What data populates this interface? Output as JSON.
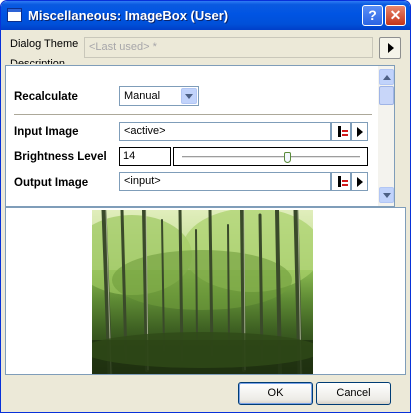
{
  "window": {
    "title": "Miscellaneous: ImageBox (User)",
    "help_glyph": "?",
    "close_glyph": "✕",
    "titlebar_color": "#0054e3"
  },
  "theme": {
    "label": "Dialog Theme",
    "value": "<Last used> *"
  },
  "description": {
    "label": "Description"
  },
  "params": {
    "recalculate": {
      "label": "Recalculate",
      "value": "Manual"
    },
    "input_image": {
      "label": "Input Image",
      "value": "<active>"
    },
    "brightness": {
      "label": "Brightness Level",
      "value": "14",
      "slider_fraction": 0.6
    },
    "output_image": {
      "label": "Output Image",
      "value": "<input>"
    }
  },
  "buttons": {
    "ok": "OK",
    "cancel": "Cancel"
  },
  "icons": [
    "window-icon",
    "help-icon",
    "close-icon",
    "expand-arrow-icon",
    "scroll-up-icon",
    "scroll-down-icon",
    "dropdown-arrow-icon",
    "data-picker-icon",
    "menu-arrow-icon",
    "slider-thumb-icon"
  ]
}
